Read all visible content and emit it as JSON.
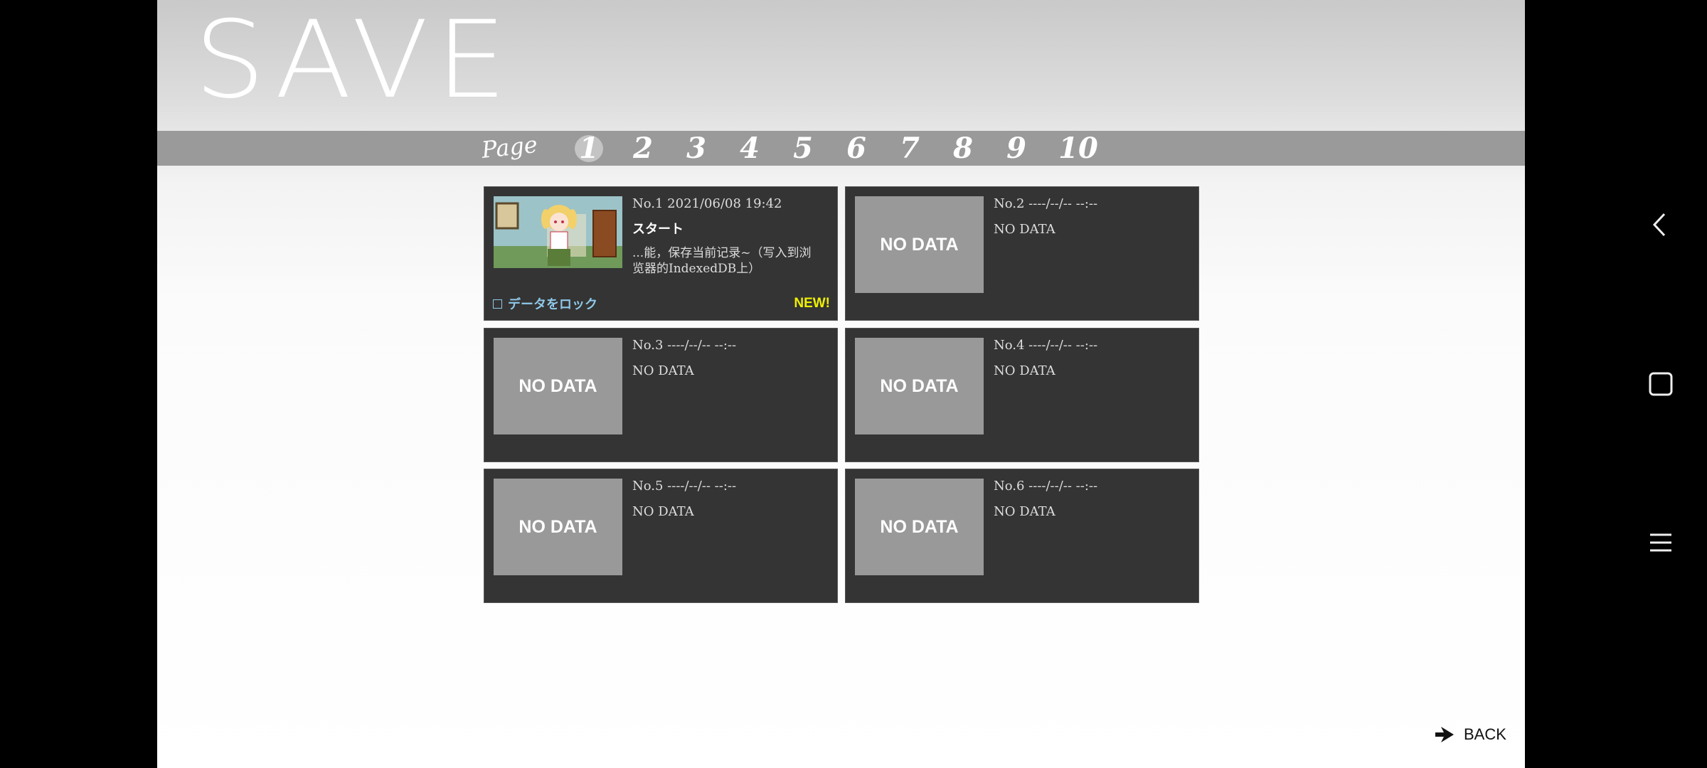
{
  "screen_title": "SAVE",
  "pager": {
    "label": "Page",
    "pages": [
      "1",
      "2",
      "3",
      "4",
      "5",
      "6",
      "7",
      "8",
      "9",
      "10"
    ],
    "active_page": "1"
  },
  "slots": [
    {
      "header": "No.1 2021/06/08 19:42",
      "title": "スタート",
      "desc": "...能，保存当前记录~（写入到浏览器的IndexedDB上）",
      "thumb": "",
      "lock_label": "データをロック",
      "badge": "NEW!"
    },
    {
      "header": "No.2 ----/--/-- --:--",
      "title": "NO DATA",
      "thumb": "NO DATA"
    },
    {
      "header": "No.3 ----/--/-- --:--",
      "title": "NO DATA",
      "thumb": "NO DATA"
    },
    {
      "header": "No.4 ----/--/-- --:--",
      "title": "NO DATA",
      "thumb": "NO DATA"
    },
    {
      "header": "No.5 ----/--/-- --:--",
      "title": "NO DATA",
      "thumb": "NO DATA"
    },
    {
      "header": "No.6 ----/--/-- --:--",
      "title": "NO DATA",
      "thumb": "NO DATA"
    }
  ],
  "back": {
    "label": "BACK"
  },
  "colors": {
    "slot_bg": "#343434",
    "thumb_empty": "#999999",
    "lock_text": "#8fc8e8",
    "new_badge": "#f0f000"
  },
  "icons": {
    "back": "arrow-right-icon",
    "nav_back": "chevron-left-icon",
    "nav_home": "square-icon",
    "nav_menu": "hamburger-menu-icon"
  }
}
